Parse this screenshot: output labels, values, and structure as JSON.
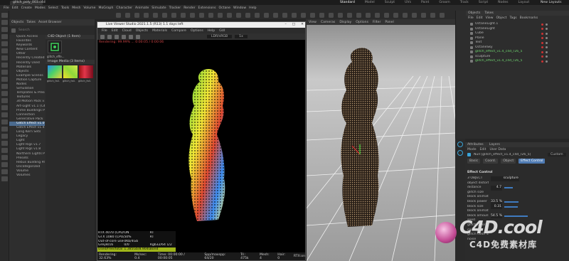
{
  "title_tab": "glitch_poly_003.c4d *",
  "menus": [
    "File",
    "Edit",
    "Create",
    "Modes",
    "Select",
    "Tools",
    "Mesh",
    "Volume",
    "MoGraph",
    "Character",
    "Animate",
    "Simulate",
    "Tracker",
    "Render",
    "Extensions",
    "Octane",
    "Window",
    "Help"
  ],
  "layout_tabs": [
    "Standard",
    "Model",
    "Sculpt",
    "UVs",
    "Paint",
    "Groom",
    "Track",
    "Script",
    "Nodes",
    "Layout"
  ],
  "active_layout": "Standard",
  "new_layouts": "New Layouts",
  "asset_browser": {
    "tabs": [
      "Objects",
      "Takes",
      "Asset Browser"
    ],
    "search_placeholder": "Search",
    "tree": [
      "Quick Access",
      "Favorites",
      "Keywords",
      "New Content",
      "Other",
      "Recently Created",
      "Recently Used",
      "Materials",
      "Objects",
      "Example Scenes",
      "Motion Capture",
      "Nodes",
      "Simulation",
      "Templates & Presets",
      "Textures",
      "3d Motion Pack v1.0",
      "Art-Light v1.1 (C4D)",
      "Prime Buildings Pack",
      "Connection",
      "Generative Pack",
      "Glitch Effect v1.0",
      "Glitch Effect v1.4",
      "Long Kern Sets",
      "Legacy",
      "Light",
      "Light Rigs v1.7",
      "Light Rigs v1.8",
      "Northern Lights Pack",
      "Presets",
      "Rebus Building Pack",
      "Uncategorized",
      "Volume",
      "Volumes"
    ],
    "selected_tree_index": 20,
    "c4d_section": "C4D Object (1 Item)",
    "c4d_item": "glitch_effe...",
    "image_section": "Image Media (3 Items)",
    "image_items": [
      "glitch_fall...",
      "glitch_fall...",
      "glitch_fall..."
    ]
  },
  "irv": {
    "title": "Live Viewer Studio 2021.1.5 (R13) 1.1 days left",
    "menu": [
      "File",
      "Edit",
      "Cloud",
      "Objects",
      "Materials",
      "Compare",
      "Options",
      "Help",
      "GUI"
    ],
    "status": "Rendering: 99.99% ... 0:00:05 / 0:00:06",
    "toolbar_values": [
      "LDR/sRGB",
      "1x"
    ],
    "stats_rows": [
      [
        "RTX 4070 (CPU/W)",
        "ON",
        "RT"
      ],
      [
        "GTX 1080 (CPU/W)",
        "50%",
        "RT"
      ],
      [
        "Out-of-core used/max",
        "0Kb/4Gb",
        ""
      ],
      [
        "Grey8/16",
        "0/0",
        "Rgb32/64 1/2"
      ],
      [
        "Used/free/total vram",
        "1.385Gb/8.904Gb/11Gb",
        "Bond"
      ]
    ],
    "bottom": [
      "Rendering: 32.63%",
      "Ms/sec: 0.4",
      "Time: 00:00:00 / 00:00:05",
      "Spp/maxspp: 64/20",
      "Tri: 475k",
      "Mesh: 4",
      "Hair: 0",
      "RTX:on"
    ]
  },
  "viewport": {
    "menu": [
      "View",
      "Cameras",
      "Display",
      "Options",
      "Filter",
      "Panel"
    ]
  },
  "objects": {
    "tabs": [
      "Objects",
      "Takes"
    ],
    "menu": [
      "File",
      "Edit",
      "View",
      "Object",
      "Tags",
      "Bookmarks"
    ],
    "items": [
      {
        "name": "OctaneLight.1",
        "green": false
      },
      {
        "name": "OctaneLight",
        "green": false
      },
      {
        "name": "Cube",
        "green": false
      },
      {
        "name": "Plane",
        "green": false
      },
      {
        "name": "Text",
        "green": false
      },
      {
        "name": "OctaneSky",
        "green": false
      },
      {
        "name": "glitch_effect_v1.4_c4d_r26_5",
        "green": true
      },
      {
        "name": "sculpture",
        "green": false
      },
      {
        "name": "glitch_effect_v1.4_c4d_r26_5",
        "green": true
      }
    ]
  },
  "attributes": {
    "tabs": [
      "Attributes",
      "Layers"
    ],
    "mode": "Mode",
    "edit": "Edit",
    "user_data": "User Data",
    "object_name": "Null [glitch_effect_v1.4_c4d_r26_5]",
    "custom": "Custom",
    "sub_tabs": [
      "Basic",
      "Coord.",
      "Object",
      "Effect Control"
    ],
    "active_sub_tab": "Effect Control",
    "section": "Effect Control",
    "fields": [
      {
        "label": "3 OBJECT",
        "value": "sculpture",
        "bar": 0
      },
      {
        "label": "object distortion",
        "value": "",
        "bar": 0
      },
      {
        "label": "distance",
        "value": "4.7",
        "bar": 0.2
      },
      {
        "label": "glitch size",
        "value": "",
        "bar": 0
      },
      {
        "label": "block animation",
        "value": "",
        "bar": 0
      },
      {
        "label": "block power",
        "value": "33.5 %",
        "bar": 0.34
      },
      {
        "label": "block size",
        "value": "0.31",
        "bar": 0.31
      },
      {
        "label": "block animation speed",
        "value": "",
        "bar": 0
      },
      {
        "label": "block amount",
        "value": "54.5 %",
        "bar": 0.55
      },
      {
        "label": "seed",
        "value": "",
        "bar": 0
      },
      {
        "label": "glitch color",
        "value": "",
        "bar": 0
      },
      {
        "label": "color",
        "value": "",
        "bar": 0
      },
      {
        "label": "glitch color size",
        "value": "",
        "bar": 0
      },
      {
        "label": "noise",
        "value": "",
        "bar": 0
      }
    ]
  },
  "watermark": {
    "logo": "C4D.cool",
    "sub": "C4D免费素材库"
  }
}
